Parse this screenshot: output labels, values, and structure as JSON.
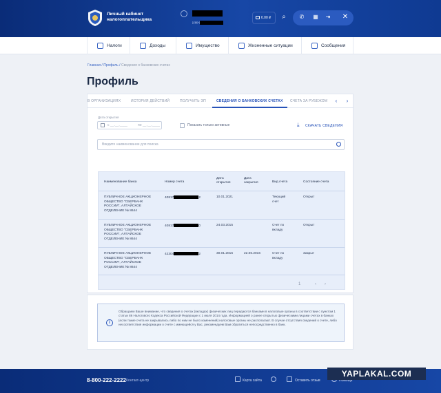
{
  "header": {
    "brand_line1": "Личный кабинет",
    "brand_line2": "налогоплательщика",
    "inn_label": "ИНН",
    "wallet": "0.00 ₽"
  },
  "nav": {
    "items": [
      {
        "label": "Налоги",
        "icon": "taxes-icon"
      },
      {
        "label": "Доходы",
        "icon": "income-icon"
      },
      {
        "label": "Имущество",
        "icon": "property-icon"
      },
      {
        "label": "Жизненные ситуации",
        "icon": "life-situations-icon"
      },
      {
        "label": "Сообщения",
        "icon": "messages-icon"
      }
    ]
  },
  "breadcrumb": {
    "home": "Главная",
    "profile": "Профиль",
    "current": "Сведения о банковских счетах"
  },
  "page_title": "Профиль",
  "tabs": [
    {
      "label": "В ОРГАНИЗАЦИЯХ",
      "active": false
    },
    {
      "label": "ИСТОРИЯ ДЕЙСТВИЙ",
      "active": false
    },
    {
      "label": "ПОЛУЧИТЬ ЭП",
      "active": false
    },
    {
      "label": "СВЕДЕНИЯ О БАНКОВСКИХ СЧЕТАХ",
      "active": true
    },
    {
      "label": "СЧЕТА ЗА РУБЕЖОМ",
      "active": false
    }
  ],
  "filters": {
    "date_label": "Дата открытия",
    "from_placeholder": "с __.__.____",
    "to_placeholder": "по __.__.____",
    "only_active_label": "Показать только активные",
    "download_label": "СКАЧАТЬ СВЕДЕНИЯ",
    "search_placeholder": "Введите наименование для поиска"
  },
  "table": {
    "headers": [
      "Наименование банка",
      "Номер счета",
      "Дата открытия",
      "Дата закрытия",
      "Вид счета",
      "Состояние счета"
    ],
    "rows": [
      {
        "bank": "ПУБЛИЧНОЕ АКЦИОНЕРНОЕ ОБЩЕСТВО \"СБЕРБАНК РОССИИ\", АЛТАЙСКОЕ ОТДЕЛЕНИЕ № 8644",
        "acc_prefix": "40817",
        "acc_suffix": "2",
        "opened": "10.01.2021",
        "closed": "",
        "type": "Текущий счет",
        "status": "Открыт"
      },
      {
        "bank": "ПУБЛИЧНОЕ АКЦИОНЕРНОЕ ОБЩЕСТВО \"СБЕРБАНК РОССИИ\", АЛТАЙСКОЕ ОТДЕЛЕНИЕ № 8644",
        "acc_prefix": "40817",
        "acc_suffix": "0",
        "opened": "24.03.2015",
        "closed": "",
        "type": "Счет по вкладу",
        "status": "Открыт"
      },
      {
        "bank": "ПУБЛИЧНОЕ АКЦИОНЕРНОЕ ОБЩЕСТВО \"СБЕРБАНК РОССИИ\", АЛТАЙСКОЕ ОТДЕЛЕНИЕ № 8644",
        "acc_prefix": "42304",
        "acc_suffix": "2",
        "opened": "30.01.2016",
        "closed": "22.06.2016",
        "type": "Счет по вкладу",
        "status": "Закрыт"
      }
    ],
    "page": "1"
  },
  "notice": "Обращаем Ваше внимание, что сведения о счетах (вкладах) физических лиц передаются банками в налоговые органы в соответствии с пунктом 1 статьи 86 Налогового Кодекса Российской Федерации с 1 июля 2014 года. Информацией о ранее открытых физическими лицами счетах в банках (если такие счета не закрывались либо по ним не было изменений) налоговые органы не располагают. В случае отсутствия сведений о счете, либо несоответствия информации о счете с имеющейся у Вас, рекомендуем Вам обратиться непосредственно в банк.",
  "footer": {
    "phone": "8-800-222-2222",
    "contact": "Контакт-центр",
    "sitemap": "Карта сайта",
    "feedback": "Оставить отзыв",
    "help": "Помощь"
  },
  "watermark": "YAPLAKAL.COM",
  "colors": {
    "header_bg": "#0f3a92",
    "accent": "#2652b8",
    "table_bg": "#e7eefa"
  }
}
